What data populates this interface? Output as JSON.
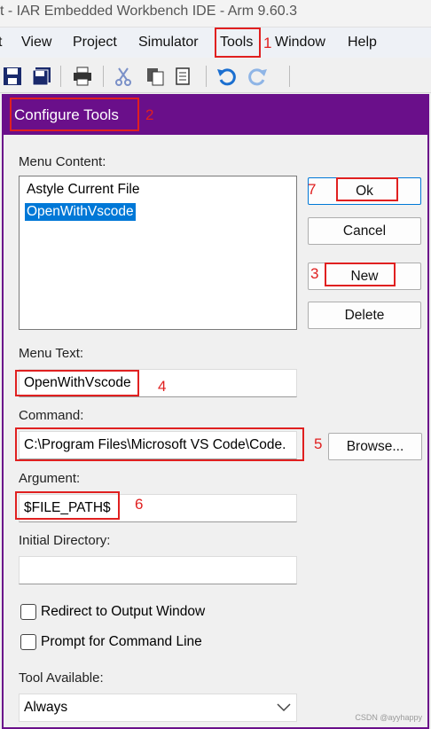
{
  "app": {
    "title": "t - IAR Embedded Workbench IDE - Arm 9.60.3"
  },
  "menubar": {
    "items": [
      {
        "label": "t"
      },
      {
        "label": "View"
      },
      {
        "label": "Project"
      },
      {
        "label": "Simulator"
      },
      {
        "label": "Tools"
      },
      {
        "label": "Window"
      },
      {
        "label": "Help"
      }
    ]
  },
  "toolbar": {
    "icons": [
      "save-icon",
      "save-all-icon",
      "print-icon",
      "cut-icon",
      "copy-icon",
      "paste-icon",
      "undo-icon",
      "redo-icon"
    ]
  },
  "annotations": [
    "1",
    "2",
    "3",
    "4",
    "5",
    "6",
    "7"
  ],
  "dialog": {
    "title": "Configure Tools",
    "menu_content_label": "Menu Content:",
    "menu_items": [
      {
        "label": "Astyle Current File",
        "selected": false
      },
      {
        "label": "OpenWithVscode",
        "selected": true
      }
    ],
    "buttons": {
      "ok": "Ok",
      "cancel": "Cancel",
      "new": "New",
      "delete": "Delete",
      "browse": "Browse..."
    },
    "menu_text_label": "Menu Text:",
    "menu_text_value": "OpenWithVscode",
    "command_label": "Command:",
    "command_value": "C:\\Program Files\\Microsoft VS Code\\Code.",
    "argument_label": "Argument:",
    "argument_value": "$FILE_PATH$",
    "initial_directory_label": "Initial Directory:",
    "initial_directory_value": "",
    "redirect_label": "Redirect to Output Window",
    "redirect_checked": false,
    "prompt_label": "Prompt for Command Line",
    "prompt_checked": false,
    "tool_available_label": "Tool Available:",
    "tool_available_value": "Always"
  },
  "watermark": "CSDN @ayyhappy",
  "colors": {
    "dialog_accent": "#6a0f8a",
    "selection": "#0078d7",
    "annotation": "#e02020"
  }
}
